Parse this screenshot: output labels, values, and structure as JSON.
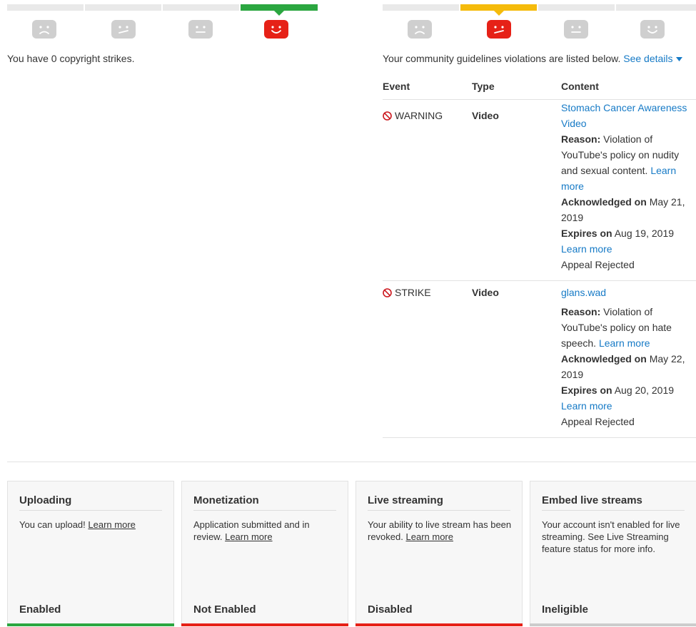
{
  "colors": {
    "segment_gray": "#e9e9e9",
    "segment_green": "#2ba640",
    "segment_yellow": "#f5bb0b",
    "face_gray": "#cfcfcf",
    "face_red": "#e62117",
    "link": "#167ac6",
    "bar_green": "#2ba640",
    "bar_red": "#e62117",
    "bar_gray": "#cccccc"
  },
  "copyright": {
    "message": "You have 0 copyright strikes.",
    "faces": [
      "frown-icon",
      "meh-slant-icon",
      "neutral-icon",
      "smile-icon"
    ],
    "active_index": 3
  },
  "community": {
    "message": "Your community guidelines violations are listed below.",
    "details_label": "See details",
    "faces": [
      "frown-icon",
      "meh-slant-icon",
      "neutral-icon",
      "smile-icon"
    ],
    "active_index": 1,
    "headers": {
      "event": "Event",
      "type": "Type",
      "content": "Content"
    },
    "rows": [
      {
        "event": "WARNING",
        "type": "Video",
        "title": "Stomach Cancer Awareness Video",
        "reason_label": "Reason:",
        "reason": "Violation of YouTube's policy on nudity and sexual content.",
        "learn_more": "Learn more",
        "ack_label": "Acknowledged on",
        "ack_date": "May 21, 2019",
        "expires_label": "Expires on",
        "expires_date": "Aug 19, 2019",
        "learn_more_2": "Learn more",
        "appeal": "Appeal Rejected"
      },
      {
        "event": "STRIKE",
        "type": "Video",
        "title": "glans.wad",
        "reason_label": "Reason:",
        "reason": "Violation of YouTube's policy on hate speech.",
        "learn_more": "Learn more",
        "ack_label": "Acknowledged on",
        "ack_date": "May 22, 2019",
        "expires_label": "Expires on",
        "expires_date": "Aug 20, 2019",
        "learn_more_2": "Learn more",
        "appeal": "Appeal Rejected"
      }
    ]
  },
  "features": [
    {
      "title": "Uploading",
      "desc": "You can upload!",
      "link": "Learn more",
      "status": "Enabled",
      "bar": "green"
    },
    {
      "title": "Monetization",
      "desc": "Application submitted and in review.",
      "link": "Learn more",
      "status": "Not Enabled",
      "bar": "red"
    },
    {
      "title": "Live streaming",
      "desc": "Your ability to live stream has been revoked.",
      "link": "Learn more",
      "status": "Disabled",
      "bar": "red"
    },
    {
      "title": "Embed live streams",
      "desc": "Your account isn't enabled for live streaming. See Live Streaming feature status for more info.",
      "link": "",
      "status": "Ineligible",
      "bar": "gray"
    }
  ]
}
